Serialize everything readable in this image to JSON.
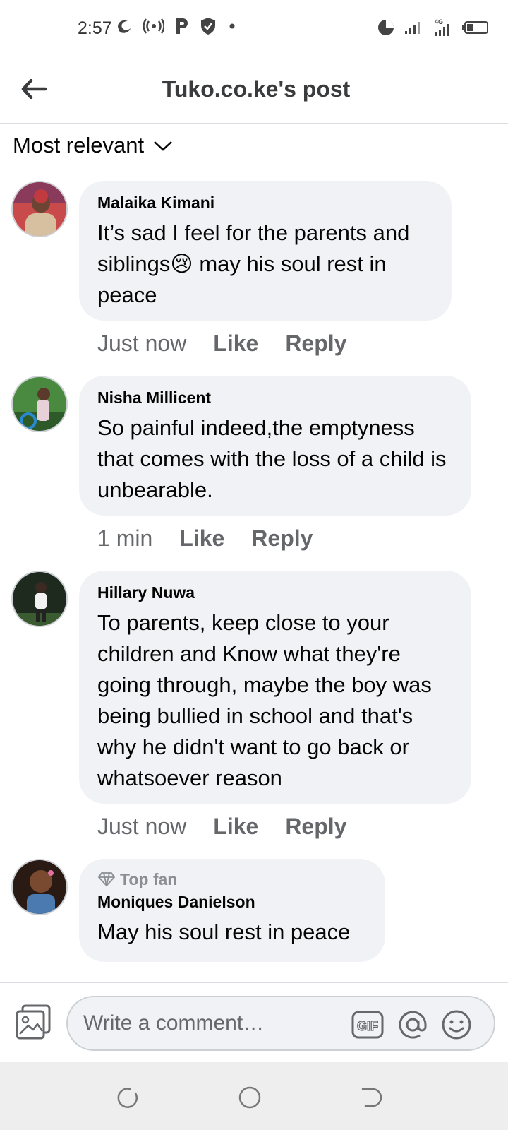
{
  "status_bar": {
    "time": "2:57",
    "network": "4G"
  },
  "header": {
    "title": "Tuko.co.ke's post"
  },
  "sort": {
    "label": "Most relevant"
  },
  "comments": [
    {
      "author": "Malaika Kimani",
      "text": "It’s sad I feel for the parents and siblings😢 may his soul rest in peace",
      "time": "Just now",
      "like": "Like",
      "reply": "Reply",
      "avatar_color": "#a0523a"
    },
    {
      "author": "Nisha Millicent",
      "text": "So painful indeed,the emptyness that comes with the loss of a child is unbearable.",
      "time": "1 min",
      "like": "Like",
      "reply": "Reply",
      "avatar_color": "#3d7a3a"
    },
    {
      "author": "Hillary Nuwa",
      "text": "To parents, keep close to your children and Know what they're going through, maybe the boy was being bullied in school and that's why he didn't want to go back or whatsoever reason",
      "time": "Just now",
      "like": "Like",
      "reply": "Reply",
      "avatar_color": "#2b3a2a"
    },
    {
      "badge": "Top fan",
      "author": "Moniques Danielson",
      "text": "May his soul rest in peace",
      "avatar_color": "#6b4a3a"
    }
  ],
  "composer": {
    "placeholder": "Write a comment…"
  },
  "colors": {
    "bubble_bg": "#f0f2f5",
    "secondary_text": "#65676b",
    "divider": "#dadde1"
  }
}
